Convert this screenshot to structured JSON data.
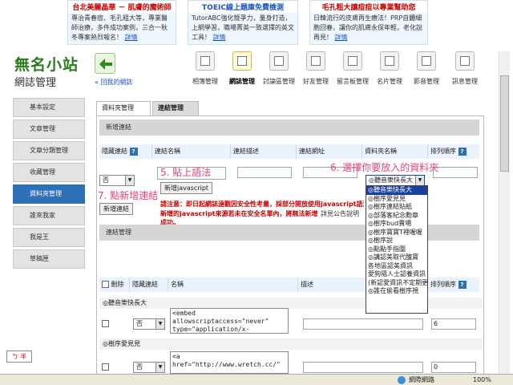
{
  "ads": [
    {
      "title": "台北美麗晶華 － 肌膚的魔術師",
      "body": "專治青春痘、毛孔粗大等，專業醫師治療，多件成功案例，三合一秋冬專案熱烈報名！",
      "more": "詳情"
    },
    {
      "title": "TOEIC線上題庫免費檢測",
      "body": "TutorABC強化競爭力，量身打造，上網學習，職場菁英一致選擇的英文工具！",
      "more": "詳情"
    },
    {
      "title": "毛孔粗大讓痘痘以專業幫助您",
      "body": "日韓流行的皮膚再生療法！PRP自體細胞回春，讓你的肌膚永保年輕，老化說再見！",
      "more": "詳情"
    }
  ],
  "brand": {
    "name": "無名小站",
    "subtitle": "網誌管理",
    "back_label": "« 回我的網誌"
  },
  "toolbar": [
    "相簿管理",
    "網誌管理",
    "討論區管理",
    "好友管理",
    "留言板管理",
    "名片管理",
    "影音管理",
    "訊息管理"
  ],
  "sidebar": [
    "基本設定",
    "文章管理",
    "文章分類管理",
    "收藏管理",
    "資料夾管理",
    "誰來我家",
    "我是王",
    "草稿匣"
  ],
  "tabs": [
    "資料夾管理",
    "連結管理"
  ],
  "new_link": {
    "section": "新增連結",
    "headers": [
      "隱藏連結",
      "連結名稱",
      "連結描述",
      "連結網址",
      "資料夾名稱",
      "排列順序"
    ],
    "hide_value": "否",
    "folder_value": "◎聽音樂快長大",
    "new_js_button": "新增javascript",
    "add_button": "新增連結",
    "notice_1": "請注意：即日起網誌遠觀因安全性考量，採部分開放使用javascript語法，",
    "notice_2": "新增的javascript來源若未在安全名單內，將無法新增成功。",
    "notice_tail": "詳見公告說明"
  },
  "annotations": {
    "a5": "5. 貼上語法",
    "a6": "6. 選擇你要放入的資料夾",
    "a7": "7. 點新增連結"
  },
  "folder_options": [
    "◎聽音樂快長大",
    "◎樹序愛見見",
    "◎樹序連結貼紙",
    "◎部落客紀念勳章",
    "◎樹序bud賣場",
    "◎樹序寶寶T裡喔喔",
    "◎樹序說",
    "◎點點手指圍",
    "◎講認美取代醜寶",
    "各地區認美資訊",
    "愛狗隨人士認養資訊",
    "(新認愛資訊不定期更",
    "◎誰在偷看樹序視"
  ],
  "link_mgmt": {
    "section": "連結管理",
    "headers": [
      "刪除",
      "隱藏連結",
      "名稱",
      "描述",
      "排列順序"
    ],
    "cats": [
      "◎聽音樂快長大",
      "◎樹序愛見見"
    ],
    "rows": [
      {
        "hide": "否",
        "code": "<embed\nallowscriptaccess=\"never\"\ntype=\"application/x-",
        "order": "6"
      },
      {
        "hide": "否",
        "code": "<a\nhref=\"http://www.wretch.cc/\"\n",
        "order": "0"
      }
    ]
  },
  "status": {
    "zone": "網際網路",
    "zoom": "100%"
  },
  "ime": "ㄅ 半"
}
